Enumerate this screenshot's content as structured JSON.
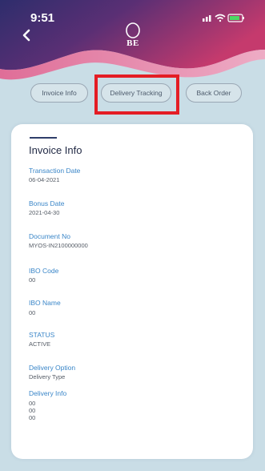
{
  "status_bar": {
    "time": "9:51"
  },
  "header": {
    "logo_text": "BE",
    "colors": {
      "gradient_start": "#2f2e6e",
      "gradient_end": "#c2366a",
      "background": "#c9dde6"
    }
  },
  "tabs": [
    {
      "label": "Invoice Info"
    },
    {
      "label": "Delivery Tracking",
      "highlighted": true
    },
    {
      "label": "Back Order"
    }
  ],
  "card": {
    "title": "Invoice Info",
    "fields": [
      {
        "label": "Transaction Date",
        "values": [
          "06-04-2021"
        ]
      },
      {
        "label": "Bonus Date",
        "values": [
          "2021-04-30"
        ]
      },
      {
        "label": "Document No",
        "values": [
          "MYOS-IN2100000000"
        ]
      },
      {
        "label": "IBO Code",
        "values": [
          "00"
        ]
      },
      {
        "label": "IBO Name",
        "values": [
          "00"
        ]
      },
      {
        "label": "STATUS",
        "values": [
          "ACTIVE"
        ]
      },
      {
        "label": "Delivery Option",
        "values": [
          "Delivery Type"
        ]
      },
      {
        "label": "Delivery Info",
        "values": [
          "00",
          "00",
          "00"
        ]
      }
    ]
  },
  "highlight_color": "#e41d25"
}
